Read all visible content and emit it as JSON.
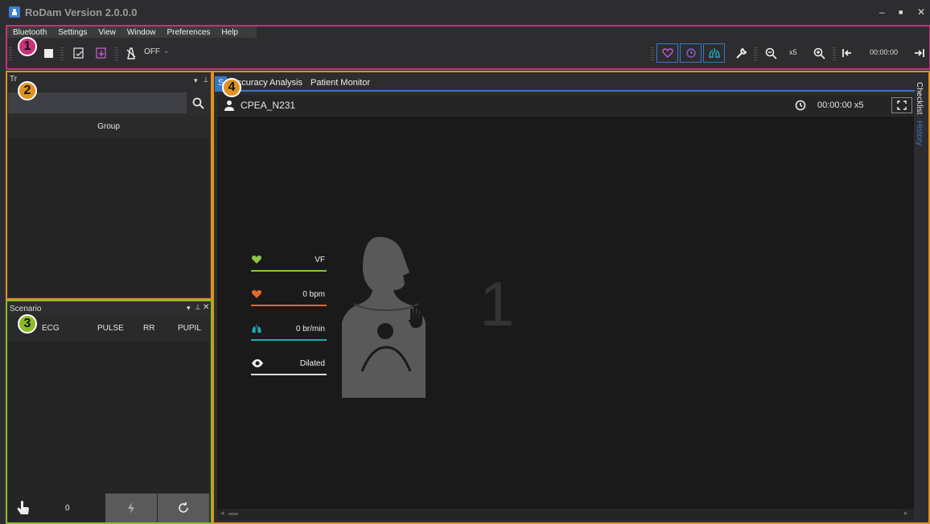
{
  "window": {
    "title": "RoDam Version 2.0.0.0",
    "min": "–",
    "max": "■",
    "close": "✕"
  },
  "menu": [
    "Bluetooth",
    "Settings",
    "View",
    "Window",
    "Preferences",
    "Help"
  ],
  "toolbar": {
    "off_label": "OFF",
    "zoom_factor": "x5",
    "time": "00:00:00"
  },
  "badges": [
    "1",
    "2",
    "3",
    "4"
  ],
  "tree_panel": {
    "title": "Tr",
    "group_header": "Group"
  },
  "scenario": {
    "title": "Scenario",
    "columns": [
      "ECG",
      "PULSE",
      "RR",
      "PUPIL"
    ],
    "count": "0"
  },
  "tabs": [
    "S",
    "Accuracy Analysis",
    "Patient Monitor"
  ],
  "patient": {
    "name": "CPEA_N231",
    "time": "00:00:00 x5"
  },
  "vitals": [
    {
      "value": "VF",
      "color": "#8cc63f"
    },
    {
      "value": "0 bpm",
      "color": "#e8662a"
    },
    {
      "value": "0 br/min",
      "color": "#1fa9b8"
    },
    {
      "value": "Dilated",
      "color": "#dddddd"
    }
  ],
  "manikin_number": "1",
  "right_tabs": {
    "checklist": "Checklist",
    "history": "History"
  },
  "colors": {
    "accent": "#3578c6",
    "frame1": "#c9317a",
    "frame2": "#e09120",
    "frame3": "#8cbb28"
  }
}
